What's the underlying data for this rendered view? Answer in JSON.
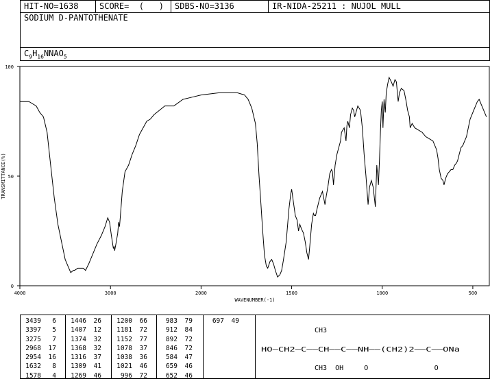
{
  "header": {
    "hit_no": "HIT-NO=1638",
    "score": "SCORE=  (   )",
    "sdbs_no": "SDBS-NO=3136",
    "ir": "IR-NIDA-25211 : NUJOL MULL",
    "compound_name": "SODIUM D-PANTOTHENATE",
    "formula_parts": [
      "C",
      "9",
      "H",
      "16",
      "NNAO",
      "5"
    ]
  },
  "chart_data": {
    "type": "line",
    "title": "",
    "xlabel": "WAVENUMBER(-1)",
    "ylabel": "TRANSMITTANCE(%)",
    "xlim": [
      4000,
      400
    ],
    "ylim": [
      0,
      100
    ],
    "x_ticks": [
      "4000",
      "3000",
      "2000",
      "1500",
      "1000",
      "500"
    ],
    "y_ticks": [
      "100",
      "50",
      "0"
    ],
    "grid": false,
    "series": [
      {
        "name": "",
        "points": [
          [
            4000,
            84
          ],
          [
            3900,
            84
          ],
          [
            3820,
            82
          ],
          [
            3780,
            79
          ],
          [
            3740,
            77
          ],
          [
            3700,
            70
          ],
          [
            3660,
            55
          ],
          [
            3620,
            40
          ],
          [
            3580,
            28
          ],
          [
            3540,
            20
          ],
          [
            3500,
            12
          ],
          [
            3470,
            9
          ],
          [
            3439,
            6
          ],
          [
            3410,
            7
          ],
          [
            3397,
            7
          ],
          [
            3360,
            8
          ],
          [
            3300,
            8
          ],
          [
            3275,
            7
          ],
          [
            3240,
            10
          ],
          [
            3200,
            14
          ],
          [
            3150,
            19
          ],
          [
            3100,
            23
          ],
          [
            3060,
            27
          ],
          [
            3030,
            31
          ],
          [
            3010,
            29
          ],
          [
            2990,
            23
          ],
          [
            2968,
            17
          ],
          [
            2960,
            18
          ],
          [
            2954,
            16
          ],
          [
            2940,
            19
          ],
          [
            2920,
            24
          ],
          [
            2910,
            29
          ],
          [
            2900,
            27
          ],
          [
            2890,
            32
          ],
          [
            2870,
            43
          ],
          [
            2840,
            52
          ],
          [
            2800,
            55
          ],
          [
            2760,
            60
          ],
          [
            2720,
            64
          ],
          [
            2680,
            69
          ],
          [
            2600,
            75
          ],
          [
            2560,
            76
          ],
          [
            2520,
            78
          ],
          [
            2460,
            80
          ],
          [
            2400,
            82
          ],
          [
            2300,
            82
          ],
          [
            2200,
            85
          ],
          [
            2100,
            86
          ],
          [
            2000,
            87
          ],
          [
            1900,
            88
          ],
          [
            1850,
            88
          ],
          [
            1800,
            88
          ],
          [
            1760,
            87
          ],
          [
            1740,
            85
          ],
          [
            1720,
            81
          ],
          [
            1700,
            74
          ],
          [
            1690,
            65
          ],
          [
            1680,
            50
          ],
          [
            1670,
            38
          ],
          [
            1660,
            25
          ],
          [
            1650,
            14
          ],
          [
            1640,
            9
          ],
          [
            1632,
            8
          ],
          [
            1620,
            11
          ],
          [
            1610,
            12
          ],
          [
            1600,
            10
          ],
          [
            1590,
            7
          ],
          [
            1578,
            4
          ],
          [
            1565,
            5
          ],
          [
            1555,
            7
          ],
          [
            1545,
            12
          ],
          [
            1530,
            20
          ],
          [
            1515,
            35
          ],
          [
            1505,
            42
          ],
          [
            1500,
            44
          ],
          [
            1490,
            38
          ],
          [
            1480,
            32
          ],
          [
            1470,
            30
          ],
          [
            1462,
            25
          ],
          [
            1455,
            28
          ],
          [
            1446,
            26
          ],
          [
            1435,
            24
          ],
          [
            1425,
            20
          ],
          [
            1416,
            15
          ],
          [
            1407,
            12
          ],
          [
            1400,
            18
          ],
          [
            1390,
            28
          ],
          [
            1380,
            33
          ],
          [
            1374,
            32
          ],
          [
            1368,
            32
          ],
          [
            1360,
            35
          ],
          [
            1345,
            40
          ],
          [
            1330,
            43
          ],
          [
            1316,
            37
          ],
          [
            1309,
            41
          ],
          [
            1300,
            45
          ],
          [
            1290,
            51
          ],
          [
            1280,
            53
          ],
          [
            1275,
            52
          ],
          [
            1269,
            46
          ],
          [
            1260,
            55
          ],
          [
            1250,
            60
          ],
          [
            1240,
            63
          ],
          [
            1230,
            66
          ],
          [
            1225,
            70
          ],
          [
            1210,
            72
          ],
          [
            1200,
            66
          ],
          [
            1195,
            73
          ],
          [
            1190,
            75
          ],
          [
            1181,
            72
          ],
          [
            1175,
            78
          ],
          [
            1165,
            81
          ],
          [
            1158,
            80
          ],
          [
            1152,
            77
          ],
          [
            1145,
            79
          ],
          [
            1135,
            82
          ],
          [
            1120,
            80
          ],
          [
            1110,
            72
          ],
          [
            1100,
            60
          ],
          [
            1090,
            50
          ],
          [
            1078,
            37
          ],
          [
            1070,
            45
          ],
          [
            1060,
            48
          ],
          [
            1050,
            45
          ],
          [
            1038,
            36
          ],
          [
            1030,
            55
          ],
          [
            1021,
            46
          ],
          [
            1015,
            58
          ],
          [
            1010,
            70
          ],
          [
            1005,
            80
          ],
          [
            1000,
            84
          ],
          [
            996,
            72
          ],
          [
            990,
            85
          ],
          [
            983,
            79
          ],
          [
            978,
            88
          ],
          [
            970,
            92
          ],
          [
            962,
            95
          ],
          [
            950,
            93
          ],
          [
            940,
            91
          ],
          [
            930,
            94
          ],
          [
            922,
            93
          ],
          [
            912,
            84
          ],
          [
            905,
            88
          ],
          [
            895,
            90
          ],
          [
            880,
            89
          ],
          [
            870,
            85
          ],
          [
            860,
            80
          ],
          [
            850,
            77
          ],
          [
            846,
            72
          ],
          [
            835,
            74
          ],
          [
            820,
            72
          ],
          [
            800,
            71
          ],
          [
            780,
            70
          ],
          [
            760,
            68
          ],
          [
            740,
            67
          ],
          [
            720,
            66
          ],
          [
            700,
            62
          ],
          [
            692,
            58
          ],
          [
            685,
            53
          ],
          [
            675,
            49
          ],
          [
            665,
            48
          ],
          [
            659,
            46
          ],
          [
            650,
            49
          ],
          [
            640,
            51
          ],
          [
            630,
            52
          ],
          [
            620,
            53
          ],
          [
            610,
            53
          ],
          [
            600,
            55
          ],
          [
            590,
            56
          ],
          [
            584,
            57
          ],
          [
            575,
            60
          ],
          [
            565,
            63
          ],
          [
            555,
            64
          ],
          [
            545,
            66
          ],
          [
            535,
            68
          ],
          [
            525,
            72
          ],
          [
            515,
            76
          ],
          [
            505,
            78
          ],
          [
            495,
            80
          ],
          [
            485,
            82
          ],
          [
            475,
            84
          ],
          [
            465,
            85
          ],
          [
            455,
            83
          ],
          [
            445,
            81
          ],
          [
            435,
            79
          ],
          [
            425,
            77
          ]
        ]
      }
    ],
    "peaks": [
      [
        3439,
        6
      ],
      [
        3397,
        5
      ],
      [
        3275,
        7
      ],
      [
        2968,
        17
      ],
      [
        2954,
        16
      ],
      [
        1632,
        8
      ],
      [
        1578,
        4
      ],
      [
        1446,
        26
      ],
      [
        1407,
        12
      ],
      [
        1374,
        32
      ],
      [
        1368,
        32
      ],
      [
        1316,
        37
      ],
      [
        1309,
        41
      ],
      [
        1269,
        46
      ],
      [
        1200,
        66
      ],
      [
        1181,
        72
      ],
      [
        1152,
        77
      ],
      [
        1078,
        37
      ],
      [
        1038,
        36
      ],
      [
        1021,
        46
      ],
      [
        996,
        72
      ],
      [
        983,
        79
      ],
      [
        912,
        84
      ],
      [
        892,
        72
      ],
      [
        846,
        72
      ],
      [
        584,
        47
      ],
      [
        659,
        46
      ],
      [
        652,
        46
      ],
      [
        697,
        49
      ]
    ]
  },
  "structure": {
    "line1": "CH3",
    "line2": "HO—CH2—C——CH——C——NH——(CH2)2——C——ONa",
    "line3": "CH3  OH     O                O"
  },
  "colors": {
    "line": "#000000",
    "background": "#ffffff"
  }
}
